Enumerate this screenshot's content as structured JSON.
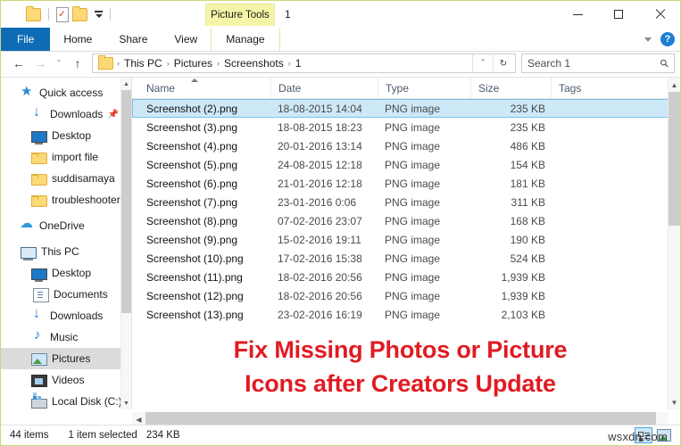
{
  "window": {
    "title": "1",
    "contextual_tab_header": "Picture Tools",
    "controls": {
      "minimize": "Minimize",
      "maximize": "Maximize",
      "close": "Close"
    }
  },
  "quick_access_toolbar": {
    "items": [
      {
        "name": "folder-icon",
        "label": "Folder"
      },
      {
        "name": "properties-icon",
        "label": "Properties"
      },
      {
        "name": "new-folder-icon",
        "label": "New folder"
      },
      {
        "name": "customize-dropdown-icon",
        "label": "Customize Quick Access Toolbar"
      }
    ]
  },
  "ribbon": {
    "tabs": [
      {
        "label": "File",
        "selected": true,
        "contextual": false
      },
      {
        "label": "Home",
        "selected": false,
        "contextual": false
      },
      {
        "label": "Share",
        "selected": false,
        "contextual": false
      },
      {
        "label": "View",
        "selected": false,
        "contextual": false
      },
      {
        "label": "Manage",
        "selected": false,
        "contextual": true
      }
    ],
    "collapse_icon": "chevron-down-icon",
    "help_label": "?"
  },
  "address_bar": {
    "back": "←",
    "forward": "→",
    "recent": "ˇ",
    "up": "↑",
    "breadcrumbs": [
      "This PC",
      "Pictures",
      "Screenshots",
      "1"
    ],
    "separator": "›",
    "dropdown": "ˇ",
    "refresh": "↻"
  },
  "search": {
    "placeholder": "Search 1",
    "icon": "search-icon"
  },
  "navigation_pane": {
    "items": [
      {
        "label": "Quick access",
        "icon": "star-icon",
        "level": 0,
        "selected": false,
        "pinned": false
      },
      {
        "label": "Downloads",
        "icon": "download-icon",
        "level": 1,
        "selected": false,
        "pinned": true
      },
      {
        "label": "Desktop",
        "icon": "desktop-icon",
        "level": 1,
        "selected": false,
        "pinned": false
      },
      {
        "label": "import file",
        "icon": "folder-icon",
        "level": 1,
        "selected": false,
        "pinned": false
      },
      {
        "label": "suddisamaya",
        "icon": "folder-icon",
        "level": 1,
        "selected": false,
        "pinned": false
      },
      {
        "label": "troubleshooter",
        "icon": "folder-icon",
        "level": 1,
        "selected": false,
        "pinned": false
      },
      {
        "label": "OneDrive",
        "icon": "cloud-icon",
        "level": 0,
        "selected": false,
        "pinned": false
      },
      {
        "label": "This PC",
        "icon": "pc-icon",
        "level": 0,
        "selected": false,
        "pinned": false
      },
      {
        "label": "Desktop",
        "icon": "desktop-icon",
        "level": 1,
        "selected": false,
        "pinned": false
      },
      {
        "label": "Documents",
        "icon": "documents-icon",
        "level": 1,
        "selected": false,
        "pinned": false
      },
      {
        "label": "Downloads",
        "icon": "download-icon",
        "level": 1,
        "selected": false,
        "pinned": false
      },
      {
        "label": "Music",
        "icon": "music-icon",
        "level": 1,
        "selected": false,
        "pinned": false
      },
      {
        "label": "Pictures",
        "icon": "pictures-icon",
        "level": 1,
        "selected": true,
        "pinned": false
      },
      {
        "label": "Videos",
        "icon": "videos-icon",
        "level": 1,
        "selected": false,
        "pinned": false
      },
      {
        "label": "Local Disk (C:)",
        "icon": "disk-icon",
        "level": 1,
        "selected": false,
        "pinned": false
      }
    ]
  },
  "file_list": {
    "columns": [
      {
        "label": "Name",
        "sorted": "asc"
      },
      {
        "label": "Date",
        "sorted": ""
      },
      {
        "label": "Type",
        "sorted": ""
      },
      {
        "label": "Size",
        "sorted": ""
      },
      {
        "label": "Tags",
        "sorted": ""
      }
    ],
    "rows": [
      {
        "name": "Screenshot (2).png",
        "date": "18-08-2015 14:04",
        "type": "PNG image",
        "size": "235 KB",
        "tags": "",
        "selected": true
      },
      {
        "name": "Screenshot (3).png",
        "date": "18-08-2015 18:23",
        "type": "PNG image",
        "size": "235 KB",
        "tags": "",
        "selected": false
      },
      {
        "name": "Screenshot (4).png",
        "date": "20-01-2016 13:14",
        "type": "PNG image",
        "size": "486 KB",
        "tags": "",
        "selected": false
      },
      {
        "name": "Screenshot (5).png",
        "date": "24-08-2015 12:18",
        "type": "PNG image",
        "size": "154 KB",
        "tags": "",
        "selected": false
      },
      {
        "name": "Screenshot (6).png",
        "date": "21-01-2016 12:18",
        "type": "PNG image",
        "size": "181 KB",
        "tags": "",
        "selected": false
      },
      {
        "name": "Screenshot (7).png",
        "date": "23-01-2016 0:06",
        "type": "PNG image",
        "size": "311 KB",
        "tags": "",
        "selected": false
      },
      {
        "name": "Screenshot (8).png",
        "date": "07-02-2016 23:07",
        "type": "PNG image",
        "size": "168 KB",
        "tags": "",
        "selected": false
      },
      {
        "name": "Screenshot (9).png",
        "date": "15-02-2016 19:11",
        "type": "PNG image",
        "size": "190 KB",
        "tags": "",
        "selected": false
      },
      {
        "name": "Screenshot (10).png",
        "date": "17-02-2016 15:38",
        "type": "PNG image",
        "size": "524 KB",
        "tags": "",
        "selected": false
      },
      {
        "name": "Screenshot (11).png",
        "date": "18-02-2016 20:56",
        "type": "PNG image",
        "size": "1,939 KB",
        "tags": "",
        "selected": false
      },
      {
        "name": "Screenshot (12).png",
        "date": "18-02-2016 20:56",
        "type": "PNG image",
        "size": "1,939 KB",
        "tags": "",
        "selected": false
      },
      {
        "name": "Screenshot (13).png",
        "date": "23-02-2016 16:19",
        "type": "PNG image",
        "size": "2,103 KB",
        "tags": "",
        "selected": false
      }
    ]
  },
  "overlay": {
    "line1": "Fix Missing Photos or Picture",
    "line2": "Icons after Creators Update",
    "color": "#e11b22"
  },
  "status_bar": {
    "item_count": "44 items",
    "selection": "1 item selected",
    "selection_size": "234 KB",
    "view_buttons": [
      {
        "name": "details-view-button",
        "active": true
      },
      {
        "name": "large-icons-view-button",
        "active": false
      }
    ]
  },
  "watermark": {
    "text": "wsxdn.com"
  }
}
